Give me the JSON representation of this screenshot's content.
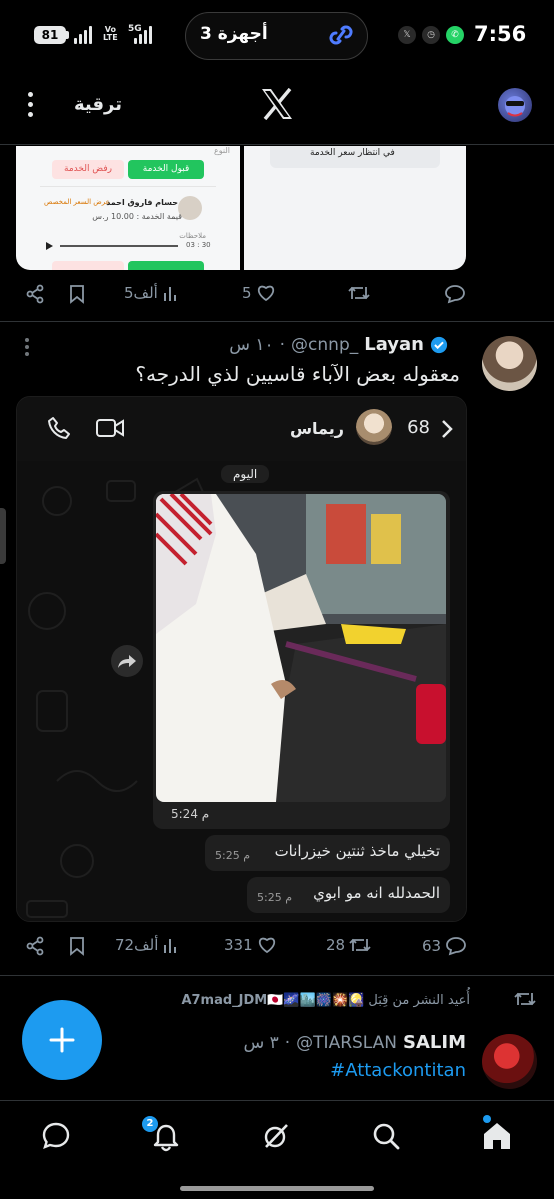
{
  "status_bar": {
    "battery": "81",
    "volte_top": "Vo",
    "volte_bottom": "LTE",
    "network": "5G",
    "devices_pill": "3 أجهزة",
    "time": "7:56",
    "tray_icons": [
      "x-app-icon",
      "clock-icon",
      "whatsapp-icon"
    ]
  },
  "top_bar": {
    "upgrade_label": "ترقية",
    "logo": "x-logo-icon"
  },
  "post1": {
    "image_left": {
      "accept_label": "قبول الخدمة",
      "reject_label": "رفض الخدمة",
      "provider_name": "حسام فاروق احمد",
      "service_price": "قيمة الخدمة : 10.00 ر.س",
      "offer_label": "عرض السعر المخصص",
      "notes_label": "ملاحظات",
      "audio_time": "03 : 30"
    },
    "image_right": {
      "waiting_label": "في انتظار سعر الخدمة"
    },
    "actions": {
      "views": "5ألف",
      "likes": "5",
      "retweets": "",
      "replies": ""
    }
  },
  "post2": {
    "name": "Layan",
    "handle": "@cnnp_",
    "time": "١٠ س",
    "text": "معقوله بعض الآباء قاسيين لذي الدرجه؟",
    "chat": {
      "back_count": "68",
      "contact_name": "ريماس",
      "date_chip": "اليوم",
      "photo_time": "5:24 م",
      "messages": [
        {
          "text": "تخيلي ماخذ ثنتين خيزرانات",
          "time": "5:25 م"
        },
        {
          "text": "الحمدلله انه مو ابوي",
          "time": "5:25 م"
        }
      ]
    },
    "actions": {
      "views": "72ألف",
      "likes": "331",
      "retweets": "28",
      "replies": "63"
    }
  },
  "post3": {
    "retweeted_by_label": "أُعيد النشر من قِبَل",
    "retweeted_by": "A7mad_JDM🇯🇵🌌🏙️🎆🎇🎑",
    "name": "SALIM",
    "handle": "@TIARSLAN",
    "time": "٣ س",
    "hashtag": "#Attackontitan"
  },
  "bottom_nav": {
    "notifications_badge": "2",
    "items": [
      "home-icon",
      "search-icon",
      "grok-icon",
      "notifications-icon",
      "messages-icon"
    ]
  },
  "colors": {
    "accent": "#1d9bf0",
    "background": "#000000",
    "text": "#e7e9ea",
    "muted": "#8b98a5",
    "divider": "#2f3336"
  }
}
